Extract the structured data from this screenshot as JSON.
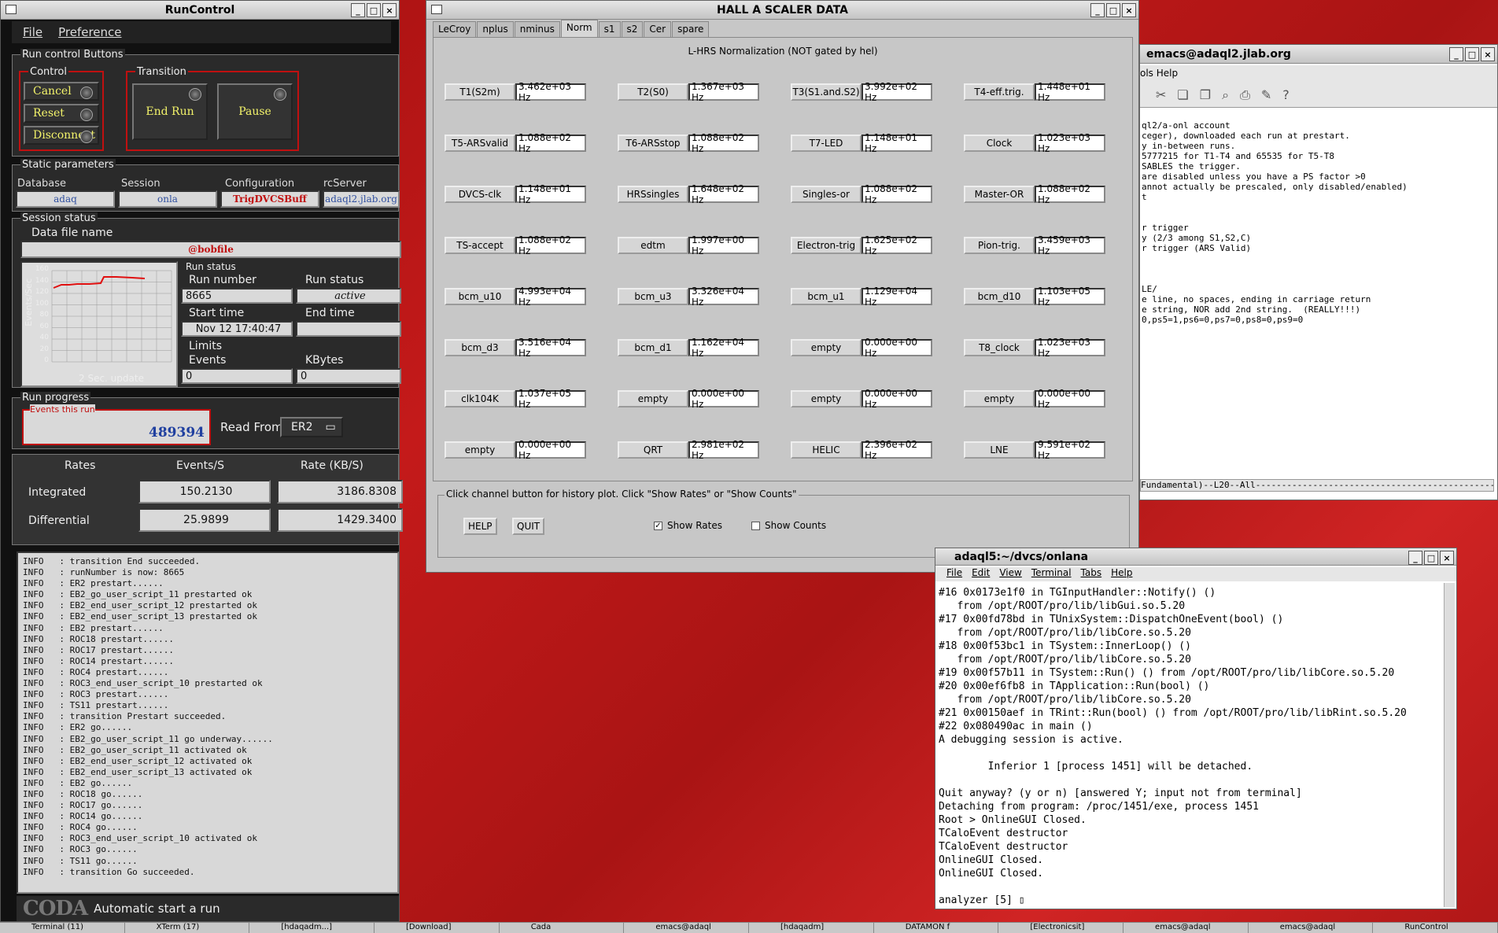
{
  "runcontrol": {
    "title": "RunControl",
    "menu": [
      "File",
      "Preference"
    ],
    "run_control_buttons": "Run control Buttons",
    "control_label": "Control",
    "transition_label": "Transition",
    "cancel": "Cancel",
    "reset": "Reset",
    "disconnect": "Disconnect",
    "end_run": "End Run",
    "pause": "Pause",
    "static_params": "Static parameters",
    "headers": [
      "Database",
      "Session",
      "Configuration",
      "rcServer"
    ],
    "values": [
      "adaq",
      "onla",
      "TrigDVCSBuff",
      "adaql2.jlab.org"
    ],
    "session_status": "Session status",
    "data_file_label": "Data file name",
    "data_file": "@bobfile",
    "chart_ylabel": "Events/Sec",
    "chart_ticks": [
      "160",
      "140",
      "120",
      "100",
      "80",
      "60",
      "40",
      "20",
      "0"
    ],
    "chart_update": "2 Sec. update",
    "run_status": "Run status",
    "run_number_label": "Run number",
    "run_number": "8665",
    "run_status_label": "Run status",
    "run_status_value": "active",
    "start_time_label": "Start time",
    "start_time": "Nov 12 17:40:47",
    "end_time_label": "End time",
    "limits": "Limits",
    "events_label": "Events",
    "events_value": "0",
    "kbytes_label": "KBytes",
    "kbytes_value": "0",
    "run_progress": "Run progress",
    "events_this_run_label": "Events this run",
    "events_this_run": "489394",
    "read_from_label": "Read From:",
    "read_from": "ER2",
    "rates_hdr": "Rates",
    "events_s_hdr": "Events/S",
    "rate_kb_hdr": "Rate (KB/S)",
    "integrated_label": "Integrated",
    "integrated_evs": "150.2130",
    "integrated_rate": "3186.8308",
    "differential_label": "Differential",
    "differential_evs": "25.9899",
    "differential_rate": "1429.3400",
    "log": [
      "INFO   : transition End succeeded.",
      "INFO   : runNumber is now: 8665",
      "INFO   : ER2 prestart......",
      "INFO   : EB2_go_user_script_11 prestarted ok",
      "INFO   : EB2_end_user_script_12 prestarted ok",
      "INFO   : EB2_end_user_script_13 prestarted ok",
      "INFO   : EB2 prestart......",
      "INFO   : ROC18 prestart......",
      "INFO   : ROC17 prestart......",
      "INFO   : ROC14 prestart......",
      "INFO   : ROC4 prestart......",
      "INFO   : ROC3_end_user_script_10 prestarted ok",
      "INFO   : ROC3 prestart......",
      "INFO   : TS11 prestart......",
      "INFO   : transition Prestart succeeded.",
      "INFO   : ER2 go......",
      "INFO   : EB2_go_user_script_11 go underway......",
      "INFO   : EB2_go_user_script_11 activated ok",
      "INFO   : EB2_end_user_script_12 activated ok",
      "INFO   : EB2_end_user_script_13 activated ok",
      "INFO   : EB2 go......",
      "INFO   : ROC18 go......",
      "INFO   : ROC17 go......",
      "INFO   : ROC14 go......",
      "INFO   : ROC4 go......",
      "INFO   : ROC3_end_user_script_10 activated ok",
      "INFO   : ROC3 go......",
      "INFO   : TS11 go......",
      "INFO   : transition Go succeeded."
    ],
    "coda_logo": "CODA",
    "footer": "Automatic start a run"
  },
  "scaler": {
    "title": "HALL  A  SCALER  DATA",
    "tabs": [
      "LeCroy",
      "nplus",
      "nminus",
      "Norm",
      "s1",
      "s2",
      "Cer",
      "spare"
    ],
    "subtitle": "L-HRS Normalization (NOT gated by hel)",
    "rows": [
      [
        [
          "T1(S2m)",
          "3.462e+03 Hz"
        ],
        [
          "T2(S0)",
          "1.367e+03 Hz"
        ],
        [
          "T3(S1.and.S2)",
          "3.992e+02 Hz"
        ],
        [
          "T4-eff.trig.",
          "1.448e+01 Hz"
        ]
      ],
      [
        [
          "T5-ARSvalid",
          "1.088e+02 Hz"
        ],
        [
          "T6-ARSstop",
          "1.088e+02 Hz"
        ],
        [
          "T7-LED",
          "1.148e+01 Hz"
        ],
        [
          "Clock",
          "1.023e+03 Hz"
        ]
      ],
      [
        [
          "DVCS-clk",
          "1.148e+01 Hz"
        ],
        [
          "HRSsingles",
          "1.648e+02 Hz"
        ],
        [
          "Singles-or",
          "1.088e+02 Hz"
        ],
        [
          "Master-OR",
          "1.088e+02 Hz"
        ]
      ],
      [
        [
          "TS-accept",
          "1.088e+02 Hz"
        ],
        [
          "edtm",
          "1.997e+00 Hz"
        ],
        [
          "Electron-trig",
          "1.625e+02 Hz"
        ],
        [
          "Pion-trig.",
          "3.459e+03 Hz"
        ]
      ],
      [
        [
          "bcm_u10",
          "4.993e+04 Hz"
        ],
        [
          "bcm_u3",
          "3.326e+04 Hz"
        ],
        [
          "bcm_u1",
          "1.129e+04 Hz"
        ],
        [
          "bcm_d10",
          "1.103e+05 Hz"
        ]
      ],
      [
        [
          "bcm_d3",
          "3.516e+04 Hz"
        ],
        [
          "bcm_d1",
          "1.162e+04 Hz"
        ],
        [
          "empty",
          "0.000e+00 Hz"
        ],
        [
          "T8_clock",
          "1.023e+03 Hz"
        ]
      ],
      [
        [
          "clk104K",
          "1.037e+05 Hz"
        ],
        [
          "empty",
          "0.000e+00 Hz"
        ],
        [
          "empty",
          "0.000e+00 Hz"
        ],
        [
          "empty",
          "0.000e+00 Hz"
        ]
      ],
      [
        [
          "empty",
          "0.000e+00 Hz"
        ],
        [
          "QRT",
          "2.981e+02 Hz"
        ],
        [
          "HELIC",
          "2.396e+02 Hz"
        ],
        [
          "LNE",
          "9.591e+02 Hz"
        ]
      ]
    ],
    "hint": "Click channel button for history plot.  Click \"Show Rates\" or \"Show Counts\"",
    "help": "HELP",
    "quit": "QUIT",
    "show_rates": "Show Rates",
    "show_counts": "Show Counts"
  },
  "emacs": {
    "title": "emacs@adaql2.jlab.org",
    "menu": "ols  Help",
    "lines": [
      "ql2/a-onl account",
      "ceger), downloaded each run at prestart.",
      "y in-between runs.",
      "5777215 for T1-T4 and 65535 for T5-T8",
      "SABLES the trigger.",
      "are disabled unless you have a PS factor >0",
      "annot actually be prescaled, only disabled/enabled)",
      "t",
      "",
      "",
      "r trigger",
      "y (2/3 among S1,S2,C)",
      "r trigger (ARS Valid)",
      "",
      "",
      "",
      "LE/",
      "e line, no spaces, ending in carriage return",
      "e string, NOR add 2nd string.  (REALLY!!!)",
      "0,ps5=1,ps6=0,ps7=0,ps8=0,ps9=0"
    ],
    "modeline": "Fundamental)--L20--All---------------------------------------------------"
  },
  "terminal": {
    "title": "adaql5:~/dvcs/onlana",
    "menu": [
      "File",
      "Edit",
      "View",
      "Terminal",
      "Tabs",
      "Help"
    ],
    "lines": [
      "#16 0x0173e1f0 in TGInputHandler::Notify() ()",
      "   from /opt/ROOT/pro/lib/libGui.so.5.20",
      "#17 0x00fd78bd in TUnixSystem::DispatchOneEvent(bool) ()",
      "   from /opt/ROOT/pro/lib/libCore.so.5.20",
      "#18 0x00f53bc1 in TSystem::InnerLoop() ()",
      "   from /opt/ROOT/pro/lib/libCore.so.5.20",
      "#19 0x00f57b11 in TSystem::Run() () from /opt/ROOT/pro/lib/libCore.so.5.20",
      "#20 0x00ef6fb8 in TApplication::Run(bool) ()",
      "   from /opt/ROOT/pro/lib/libCore.so.5.20",
      "#21 0x00150aef in TRint::Run(bool) () from /opt/ROOT/pro/lib/libRint.so.5.20",
      "#22 0x080490ac in main ()",
      "A debugging session is active.",
      "",
      "        Inferior 1 [process 1451] will be detached.",
      "",
      "Quit anyway? (y or n) [answered Y; input not from terminal]",
      "Detaching from program: /proc/1451/exe, process 1451",
      "Root > OnlineGUI Closed.",
      "TCaloEvent destructor",
      "TCaloEvent destructor",
      "OnlineGUI Closed.",
      "OnlineGUI Closed.",
      "",
      "analyzer [5] "
    ]
  },
  "taskbar": [
    "Terminal (11)",
    "XTerm (17)",
    "[hdaqadm...]",
    "[Download]",
    "Cada",
    "emacs@adaql",
    "[hdaqadm]",
    "DATAMON f",
    "[Electronicsit]",
    "emacs@adaql",
    "emacs@adaql",
    "RunControl"
  ]
}
